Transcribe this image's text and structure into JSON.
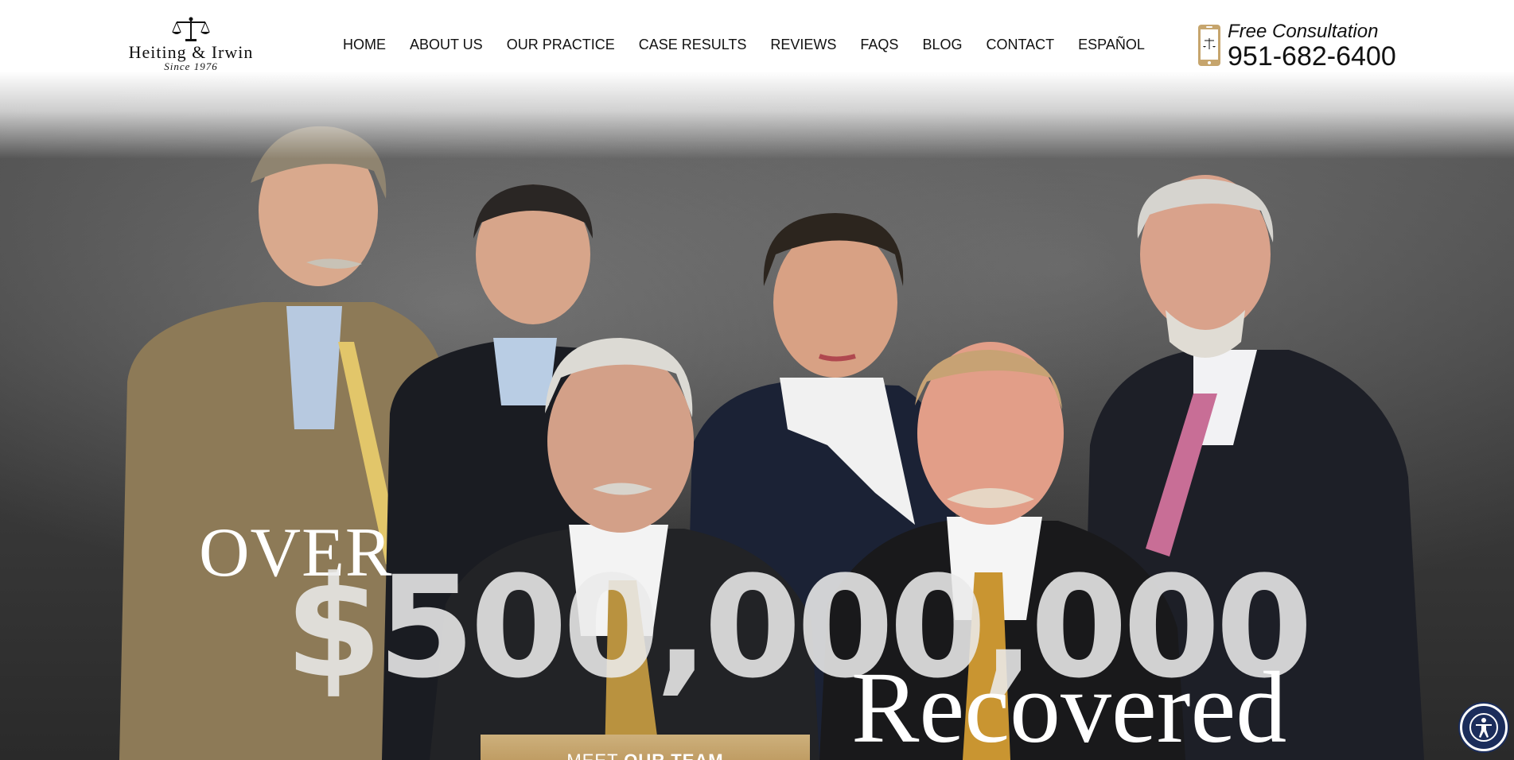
{
  "brand": {
    "name": "Heiting & Irwin",
    "since": "Since 1976"
  },
  "nav": {
    "items": [
      {
        "label": "HOME"
      },
      {
        "label": "ABOUT US"
      },
      {
        "label": "OUR PRACTICE"
      },
      {
        "label": "CASE RESULTS"
      },
      {
        "label": "REVIEWS"
      },
      {
        "label": "FAQS"
      },
      {
        "label": "BLOG"
      },
      {
        "label": "CONTACT"
      },
      {
        "label": "ESPAÑOL"
      }
    ]
  },
  "consultation": {
    "label": "Free Consultation",
    "phone": "951-682-6400",
    "icon": "phone-icon"
  },
  "hero": {
    "over": "OVER",
    "amount": "$500,000,000",
    "recovered": "Recovered",
    "cta_prefix": "MEET ",
    "cta_bold": "OUR TEAM"
  },
  "colors": {
    "accent_gold": "#b89256",
    "accessibility_navy": "#1b2d5b",
    "text_dark": "#111111"
  },
  "accessibility": {
    "icon": "accessibility-icon"
  }
}
